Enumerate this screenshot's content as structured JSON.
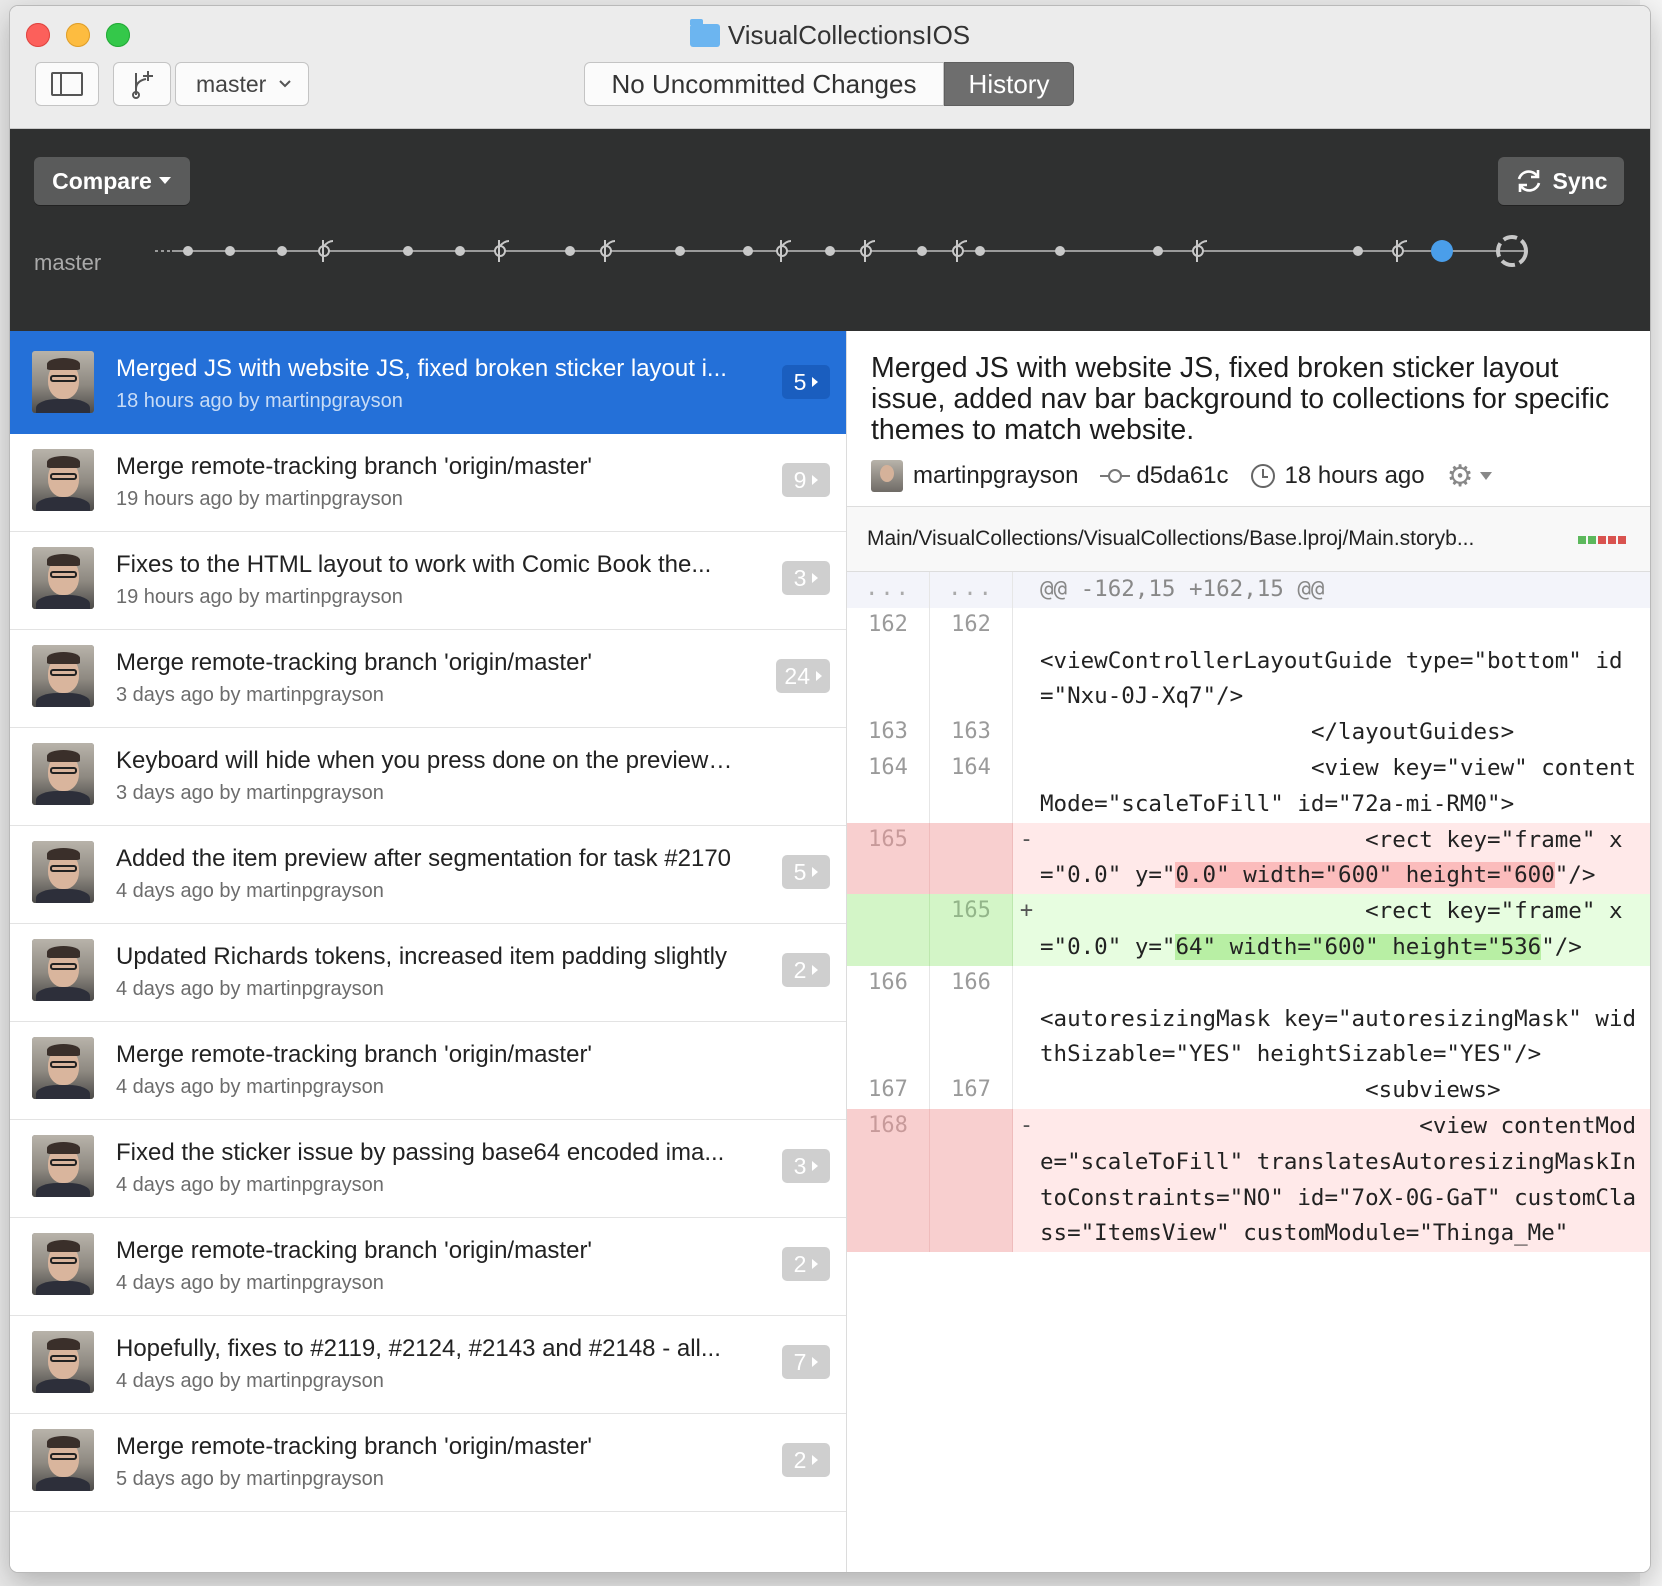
{
  "window": {
    "title": "VisualCollectionsIOS",
    "branch": "master",
    "seg_changes": "No Uncommitted Changes",
    "seg_history": "History"
  },
  "toolbar": {
    "compare_label": "Compare",
    "sync_label": "Sync",
    "timeline_branch": "master"
  },
  "colors": {
    "selection": "#2470d8",
    "deleted": "#ffe9e9",
    "added": "#e7fde0",
    "timeline_active": "#4a9eea"
  },
  "commits": [
    {
      "title": "Merged JS with website JS, fixed broken sticker layout i...",
      "meta": "18 hours ago by martinpgrayson",
      "count": "5",
      "selected": true
    },
    {
      "title": "Merge remote-tracking branch 'origin/master'",
      "meta": "19 hours ago by martinpgrayson",
      "count": "9"
    },
    {
      "title": "Fixes to the HTML layout to work with Comic Book the...",
      "meta": "19 hours ago by martinpgrayson",
      "count": "3"
    },
    {
      "title": "Merge remote-tracking branch 'origin/master'",
      "meta": "3 days ago by martinpgrayson",
      "count": "24"
    },
    {
      "title": "Keyboard will hide when you press done on the preview view",
      "meta": "3 days ago by martinpgrayson",
      "count": ""
    },
    {
      "title": "Added the item preview after segmentation for task #2170",
      "meta": "4 days ago by martinpgrayson",
      "count": "5"
    },
    {
      "title": "Updated Richards tokens, increased item padding slightly",
      "meta": "4 days ago by martinpgrayson",
      "count": "2"
    },
    {
      "title": "Merge remote-tracking branch 'origin/master'",
      "meta": "4 days ago by martinpgrayson",
      "count": ""
    },
    {
      "title": "Fixed the sticker issue by passing base64 encoded ima...",
      "meta": "4 days ago by martinpgrayson",
      "count": "3"
    },
    {
      "title": "Merge remote-tracking branch 'origin/master'",
      "meta": "4 days ago by martinpgrayson",
      "count": "2"
    },
    {
      "title": "Hopefully, fixes to #2119, #2124, #2143 and #2148 - all...",
      "meta": "4 days ago by martinpgrayson",
      "count": "7"
    },
    {
      "title": "Merge remote-tracking branch 'origin/master'",
      "meta": "5 days ago by martinpgrayson",
      "count": "2"
    }
  ],
  "detail": {
    "title": "Merged JS with website JS, fixed broken sticker layout issue, added nav bar background to collections for specific themes to match website.",
    "author": "martinpgrayson",
    "sha": "d5da61c",
    "time": "18 hours ago",
    "file_path": "Main/VisualCollections/VisualCollections/Base.lproj/Main.storyb..."
  },
  "diff": [
    {
      "type": "hunk",
      "old": "...",
      "new": "...",
      "sign": "",
      "parts": [
        {
          "t": "@@ -162,15 +162,15 @@"
        }
      ]
    },
    {
      "type": "ctx",
      "old": "162",
      "new": "162",
      "sign": "",
      "parts": [
        {
          "t": "\n<viewControllerLayoutGuide type=\"bottom\" id=\"Nxu-0J-Xq7\"/>"
        }
      ]
    },
    {
      "type": "ctx",
      "old": "163",
      "new": "163",
      "sign": "",
      "parts": [
        {
          "t": "                    </layoutGuides>"
        }
      ]
    },
    {
      "type": "ctx",
      "old": "164",
      "new": "164",
      "sign": "",
      "parts": [
        {
          "t": "                    <view key=\"view\" contentMode=\"scaleToFill\" id=\"72a-mi-RM0\">"
        }
      ]
    },
    {
      "type": "del",
      "old": "165",
      "new": "",
      "sign": "-",
      "parts": [
        {
          "t": "                        <rect key=\"frame\" x=\"0.0\" y=\""
        },
        {
          "t": "0.0\" width=\"600\" height=\"600",
          "hl": true
        },
        {
          "t": "\"/>"
        }
      ]
    },
    {
      "type": "add",
      "old": "",
      "new": "165",
      "sign": "+",
      "parts": [
        {
          "t": "                        <rect key=\"frame\" x=\"0.0\" y=\""
        },
        {
          "t": "64\" width=\"600\" height=\"536",
          "hl": true
        },
        {
          "t": "\"/>"
        }
      ]
    },
    {
      "type": "ctx",
      "old": "166",
      "new": "166",
      "sign": "",
      "parts": [
        {
          "t": "\n<autoresizingMask key=\"autoresizingMask\" widthSizable=\"YES\" heightSizable=\"YES\"/>"
        }
      ]
    },
    {
      "type": "ctx",
      "old": "167",
      "new": "167",
      "sign": "",
      "parts": [
        {
          "t": "                        <subviews>"
        }
      ]
    },
    {
      "type": "del",
      "old": "168",
      "new": "",
      "sign": "-",
      "parts": [
        {
          "t": "                            <view contentMode=\"scaleToFill\" translatesAutoresizingMaskIntoConstraints=\"NO\" id=\"7oX-0G-GaT\" customClass=\"ItemsView\" customModule=\"Thinga_Me\""
        }
      ]
    }
  ]
}
